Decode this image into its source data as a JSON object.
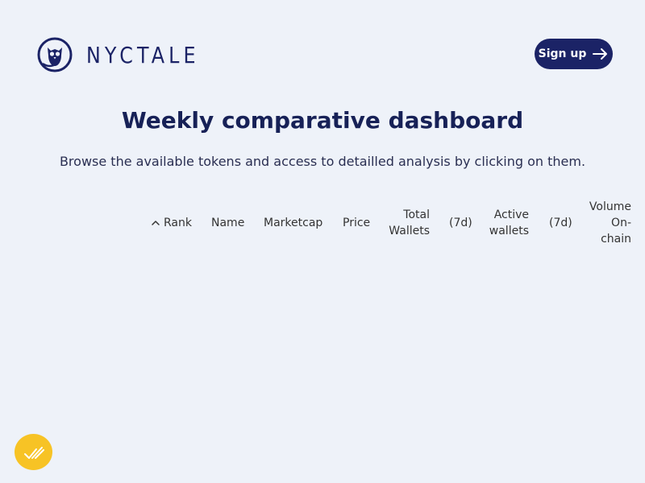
{
  "header": {
    "brand": "NYCTALE",
    "logo_icon": "owl-icon",
    "signup_label": "Sign up",
    "signup_icon": "arrow-right-icon",
    "brand_color": "#1b2366"
  },
  "main": {
    "title": "Weekly comparative dashboard",
    "subtitle": "Browse the available tokens and access to detailled analysis by clicking on them."
  },
  "table": {
    "sort_icon": "chevron-up-icon",
    "columns": {
      "rank": "Rank",
      "name": "Name",
      "marketcap": "Marketcap",
      "price": "Price",
      "total_wallets_1": "Total",
      "total_wallets_2": "Wallets",
      "total_wallets_7d": "(7d)",
      "active_wallets_1": "Active",
      "active_wallets_2": "wallets",
      "active_wallets_7d": "(7d)",
      "volume_1": "Volume",
      "volume_2": "On-",
      "volume_3": "chain"
    }
  },
  "badge": {
    "icon": "checkmarks-icon",
    "color": "#f7c325"
  }
}
